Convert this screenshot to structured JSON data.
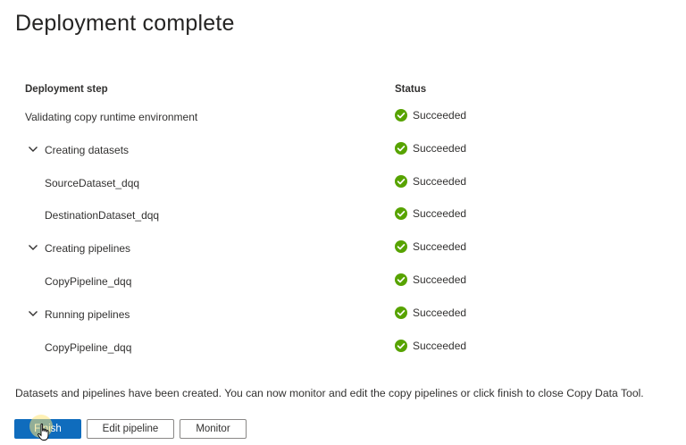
{
  "header": {
    "title": "Deployment complete"
  },
  "table": {
    "columns": {
      "step": "Deployment step",
      "status": "Status"
    },
    "rows": [
      {
        "step": "Validating copy runtime environment",
        "status": "Succeeded",
        "level": 0,
        "expandable": false
      },
      {
        "step": "Creating datasets",
        "status": "Succeeded",
        "level": 0,
        "expandable": true
      },
      {
        "step": "SourceDataset_dqq",
        "status": "Succeeded",
        "level": 1,
        "expandable": false
      },
      {
        "step": "DestinationDataset_dqq",
        "status": "Succeeded",
        "level": 1,
        "expandable": false
      },
      {
        "step": "Creating pipelines",
        "status": "Succeeded",
        "level": 0,
        "expandable": true
      },
      {
        "step": "CopyPipeline_dqq",
        "status": "Succeeded",
        "level": 1,
        "expandable": false
      },
      {
        "step": "Running pipelines",
        "status": "Succeeded",
        "level": 0,
        "expandable": true
      },
      {
        "step": "CopyPipeline_dqq",
        "status": "Succeeded",
        "level": 1,
        "expandable": false
      }
    ]
  },
  "message": "Datasets and pipelines have been created. You can now monitor and edit the copy pipelines or click finish to close Copy Data Tool.",
  "buttons": {
    "finish": "Finish",
    "edit_pipeline": "Edit pipeline",
    "monitor": "Monitor"
  },
  "icons": {
    "status": "check-circle-icon",
    "expand": "chevron-down-icon"
  },
  "colors": {
    "success": "#57a300",
    "primary": "#0f6cbd"
  }
}
